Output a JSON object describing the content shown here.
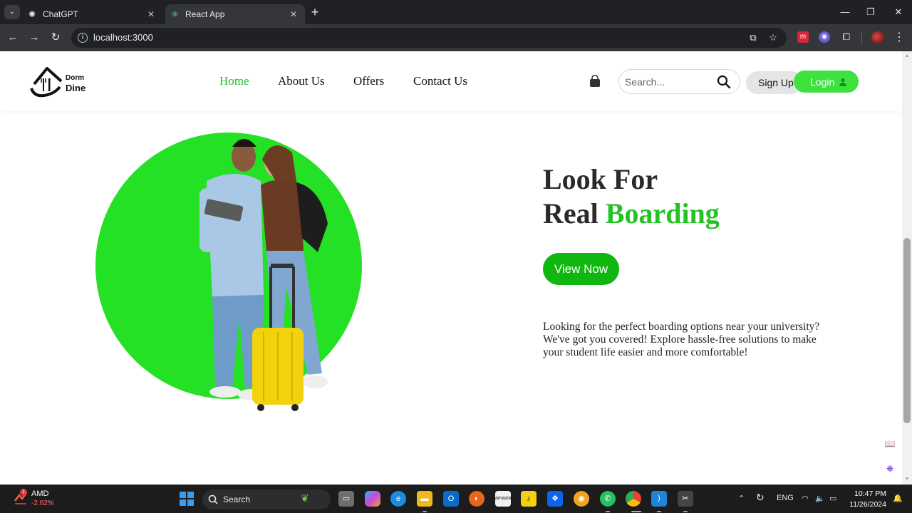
{
  "browser": {
    "tabs": [
      {
        "label": "ChatGPT"
      },
      {
        "label": "React App"
      }
    ],
    "new_tab_glyph": "+",
    "close_glyph": "✕",
    "url": "localhost:3000",
    "icons": [
      "back-icon",
      "forward-icon",
      "reload-icon",
      "site-info-icon",
      "install-app-icon",
      "bookmark-star-icon",
      "extensions-icon",
      "menu-icon"
    ]
  },
  "site": {
    "nav": [
      {
        "label": "Home",
        "active": true
      },
      {
        "label": "About Us"
      },
      {
        "label": "Offers"
      },
      {
        "label": "Contact Us"
      }
    ],
    "search_placeholder": "Search...",
    "signup_label": "Sign Up",
    "login_label": "Login",
    "logo_text": "Dorm Dine",
    "colors": {
      "accent": "#22c322",
      "button": "#11b711",
      "circle": "#25e125"
    }
  },
  "hero": {
    "title_line1": "Look For",
    "title_line2_plain": "Real ",
    "title_line2_accent": "Boarding",
    "cta_label": "View Now",
    "description": "Looking for the perfect boarding options near your university? We've got you covered! Explore hassle-free solutions to make your student life easier and more comfortable!"
  },
  "taskbar": {
    "stock_name": "AMD",
    "stock_change": "-2.62%",
    "stock_badge": "1",
    "search_label": "Search",
    "language": "ENG",
    "time": "10:47 PM",
    "date": "11/26/2024"
  }
}
